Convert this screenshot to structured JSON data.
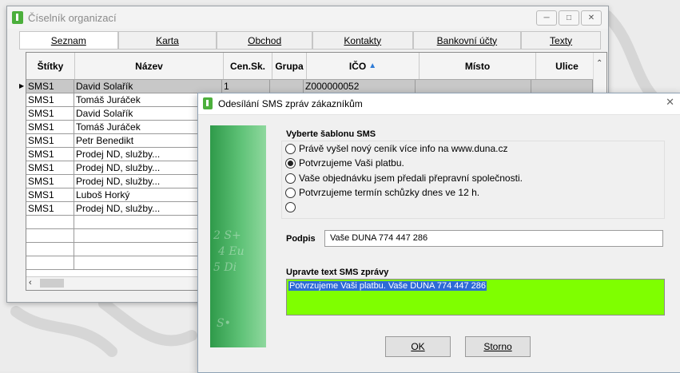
{
  "main_window": {
    "title": "Číselník organizací",
    "tabs": [
      "Seznam",
      "Karta",
      "Obchod",
      "Kontakty",
      "Bankovní účty",
      "Texty"
    ],
    "columns": [
      "Štítky",
      "Název",
      "Cen.Sk.",
      "Grupa",
      "IČO",
      "Místo",
      "Ulice"
    ],
    "rows": [
      [
        "SMS1",
        "David Solařík",
        "1",
        "",
        "Z000000052",
        "",
        ""
      ],
      [
        "SMS1",
        "Tomáš  Juráček",
        "",
        "",
        "",
        "",
        ""
      ],
      [
        "SMS1",
        "David Solařík",
        "",
        "",
        "",
        "",
        ""
      ],
      [
        "SMS1",
        "Tomáš  Juráček",
        "",
        "",
        "",
        "",
        ""
      ],
      [
        "SMS1",
        "Petr Benedikt",
        "",
        "",
        "",
        "",
        ""
      ],
      [
        "SMS1",
        "Prodej ND, služby...",
        "",
        "",
        "",
        "",
        ""
      ],
      [
        "SMS1",
        "Prodej ND, služby...",
        "",
        "",
        "",
        "",
        ""
      ],
      [
        "SMS1",
        "Prodej ND, služby...",
        "",
        "",
        "",
        "",
        ""
      ],
      [
        "SMS1",
        "Luboš Horký",
        "",
        "",
        "",
        "",
        ""
      ],
      [
        "SMS1",
        "Prodej ND, služby...",
        "",
        "",
        "",
        "",
        ""
      ],
      [
        "",
        "",
        "",
        "",
        "",
        "",
        ""
      ],
      [
        "",
        "",
        "",
        "",
        "",
        "",
        ""
      ],
      [
        "",
        "",
        "",
        "",
        "",
        "",
        ""
      ],
      [
        "",
        "",
        "",
        "",
        "",
        "",
        ""
      ]
    ]
  },
  "dialog": {
    "title": "Odesílání SMS zpráv zákazníkům",
    "template_label": "Vyberte šablonu SMS",
    "options": [
      "Právě vyšel nový ceník více info na www.duna.cz",
      "Potvrzujeme Vaši platbu.",
      "Vaše objednávku jsem předali přepravní společnosti.",
      "Potvrzujeme termín schůzky dnes ve 12 h.",
      ""
    ],
    "selected_option": 1,
    "signature_label": "Podpis",
    "signature_value": "Vaše DUNA 774 447 286",
    "edit_label": "Upravte text SMS zprávy",
    "sms_text": "Potvrzujeme Vaši platbu. Vaše DUNA 774 447 286",
    "ok_label": "OK",
    "cancel_label": "Storno"
  },
  "colors": {
    "sms_area_bg": "#7fff00",
    "accent_green": "#4caf3c",
    "selection_blue": "#2e6bd6"
  },
  "icons": {
    "sort": "sort-asc-icon",
    "close": "close-icon"
  }
}
